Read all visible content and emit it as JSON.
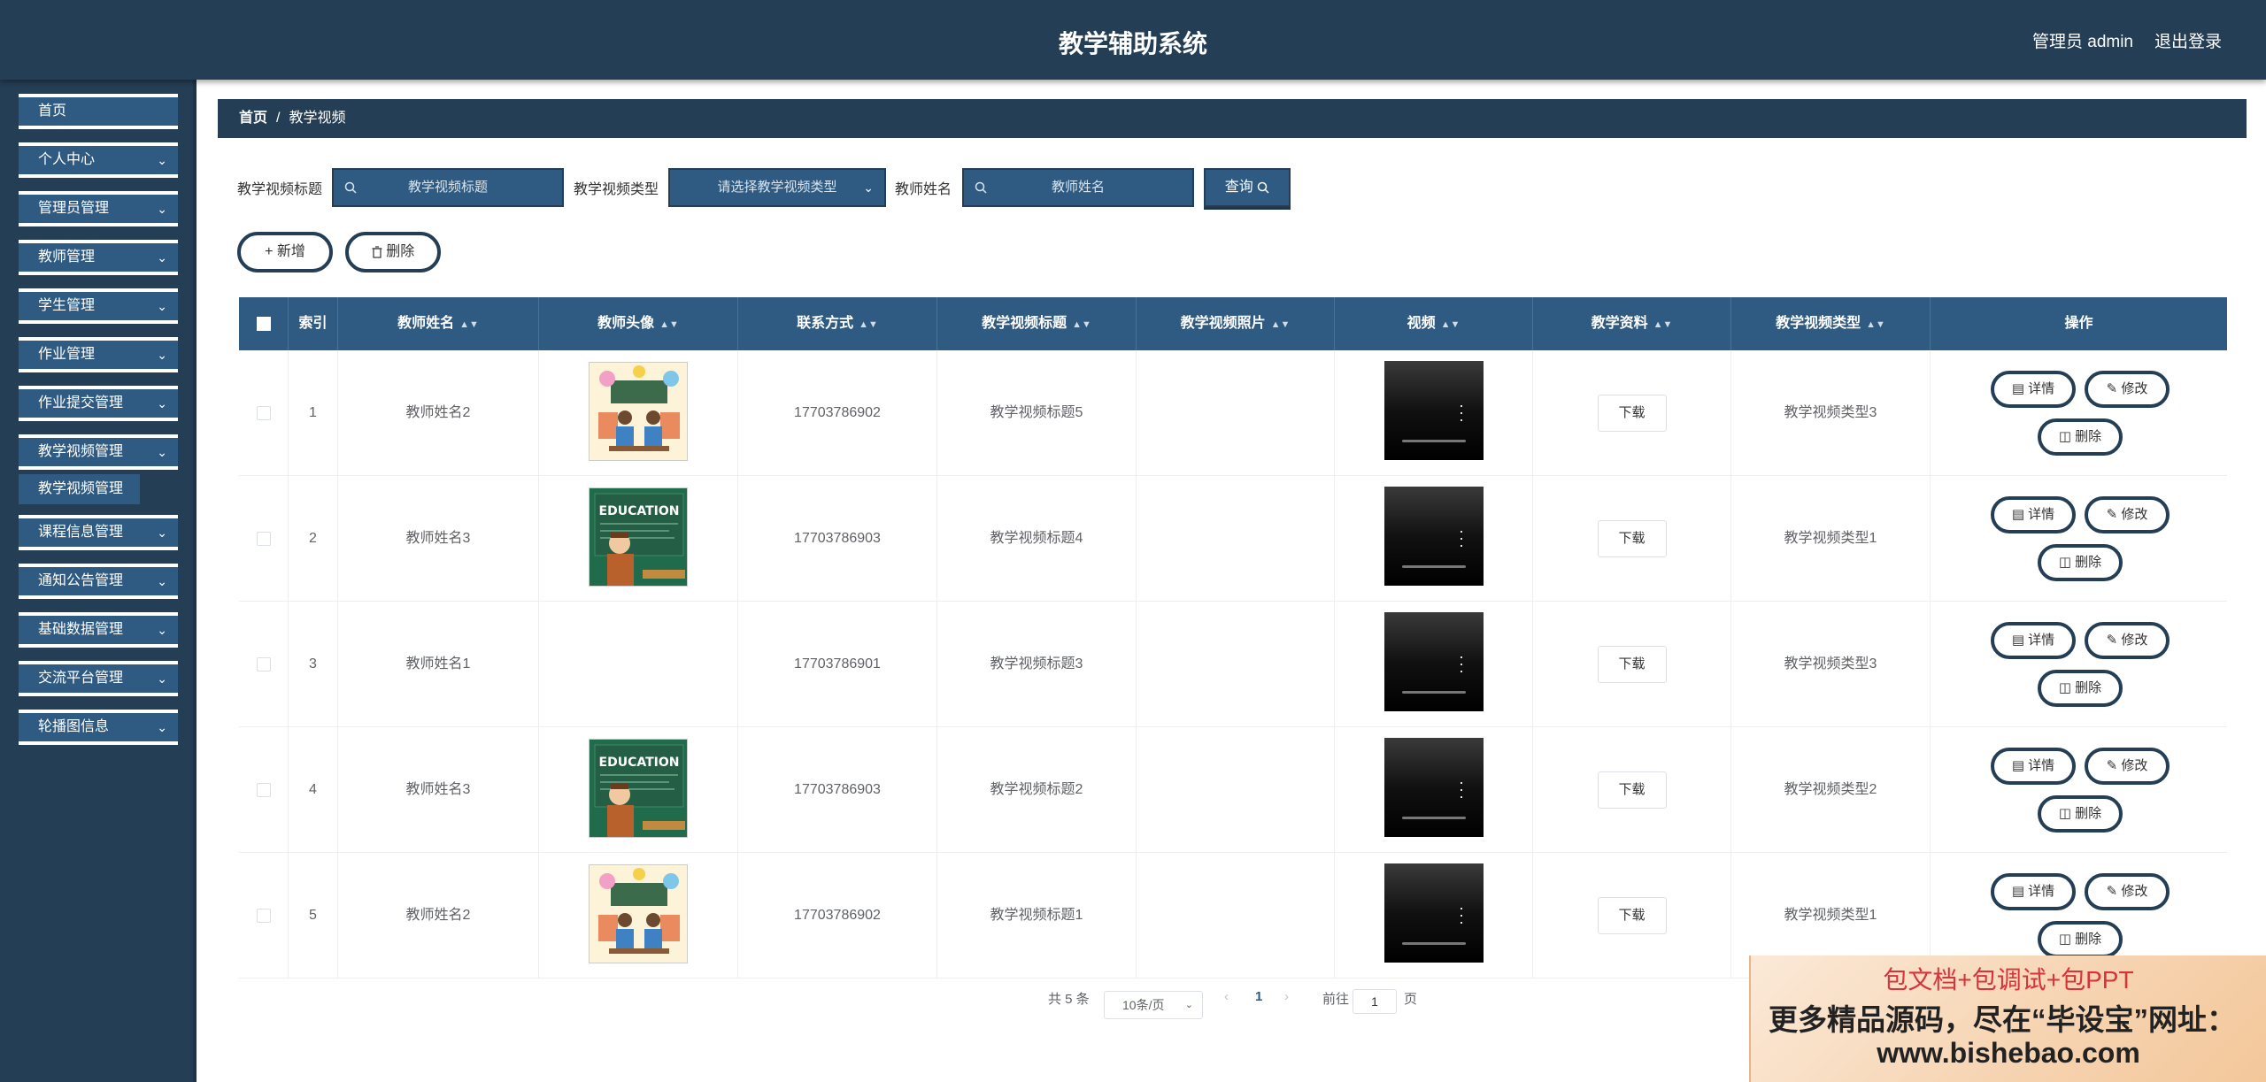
{
  "header": {
    "title": "教学辅助系统",
    "user": "管理员 admin",
    "logout": "退出登录"
  },
  "sidebar": {
    "items": [
      {
        "label": "首页",
        "chevron": false
      },
      {
        "label": "个人中心",
        "chevron": true
      },
      {
        "label": "管理员管理",
        "chevron": true
      },
      {
        "label": "教师管理",
        "chevron": true
      },
      {
        "label": "学生管理",
        "chevron": true
      },
      {
        "label": "作业管理",
        "chevron": true
      },
      {
        "label": "作业提交管理",
        "chevron": true
      },
      {
        "label": "教学视频管理",
        "chevron": true
      },
      {
        "label": "课程信息管理",
        "chevron": true
      },
      {
        "label": "通知公告管理",
        "chevron": true
      },
      {
        "label": "基础数据管理",
        "chevron": true
      },
      {
        "label": "交流平台管理",
        "chevron": true
      },
      {
        "label": "轮播图信息",
        "chevron": true
      }
    ],
    "submenu": "教学视频管理"
  },
  "breadcrumb": {
    "home": "首页",
    "separator": "/",
    "current": "教学视频"
  },
  "search": {
    "title_label": "教学视频标题",
    "title_placeholder": "教学视频标题",
    "type_label": "教学视频类型",
    "type_placeholder": "请选择教学视频类型",
    "teacher_label": "教师姓名",
    "teacher_placeholder": "教师姓名",
    "query_label": "查询"
  },
  "actions": {
    "add_label": "新增",
    "delete_label": "删除"
  },
  "table": {
    "columns": [
      "索引",
      "教师姓名",
      "教师头像",
      "联系方式",
      "教学视频标题",
      "教学视频照片",
      "视频",
      "教学资料",
      "教学视频类型",
      "操作"
    ],
    "download_label": "下载",
    "detail_label": "详情",
    "edit_label": "修改",
    "delete_label": "删除",
    "rows": [
      {
        "index": "1",
        "teacher": "教师姓名2",
        "avatar": "classroom",
        "phone": "17703786902",
        "title": "教学视频标题5",
        "type": "教学视频类型3"
      },
      {
        "index": "2",
        "teacher": "教师姓名3",
        "avatar": "education",
        "phone": "17703786903",
        "title": "教学视频标题4",
        "type": "教学视频类型1"
      },
      {
        "index": "3",
        "teacher": "教师姓名1",
        "avatar": "none",
        "phone": "17703786901",
        "title": "教学视频标题3",
        "type": "教学视频类型3"
      },
      {
        "index": "4",
        "teacher": "教师姓名3",
        "avatar": "education",
        "phone": "17703786903",
        "title": "教学视频标题2",
        "type": "教学视频类型2"
      },
      {
        "index": "5",
        "teacher": "教师姓名2",
        "avatar": "classroom",
        "phone": "17703786902",
        "title": "教学视频标题1",
        "type": "教学视频类型1"
      }
    ]
  },
  "pagination": {
    "total": "共 5 条",
    "page_size": "10条/页",
    "current_page": "1",
    "goto_label": "前往",
    "goto_value": "1",
    "page_suffix": "页"
  },
  "ad": {
    "line1": "包文档+包调试+包PPT",
    "line2": "更多精品源码，尽在“毕设宝”网址：",
    "line3": "www.bishebao.com"
  },
  "colors": {
    "primary": "#243e55",
    "accent": "#2f5b82"
  }
}
